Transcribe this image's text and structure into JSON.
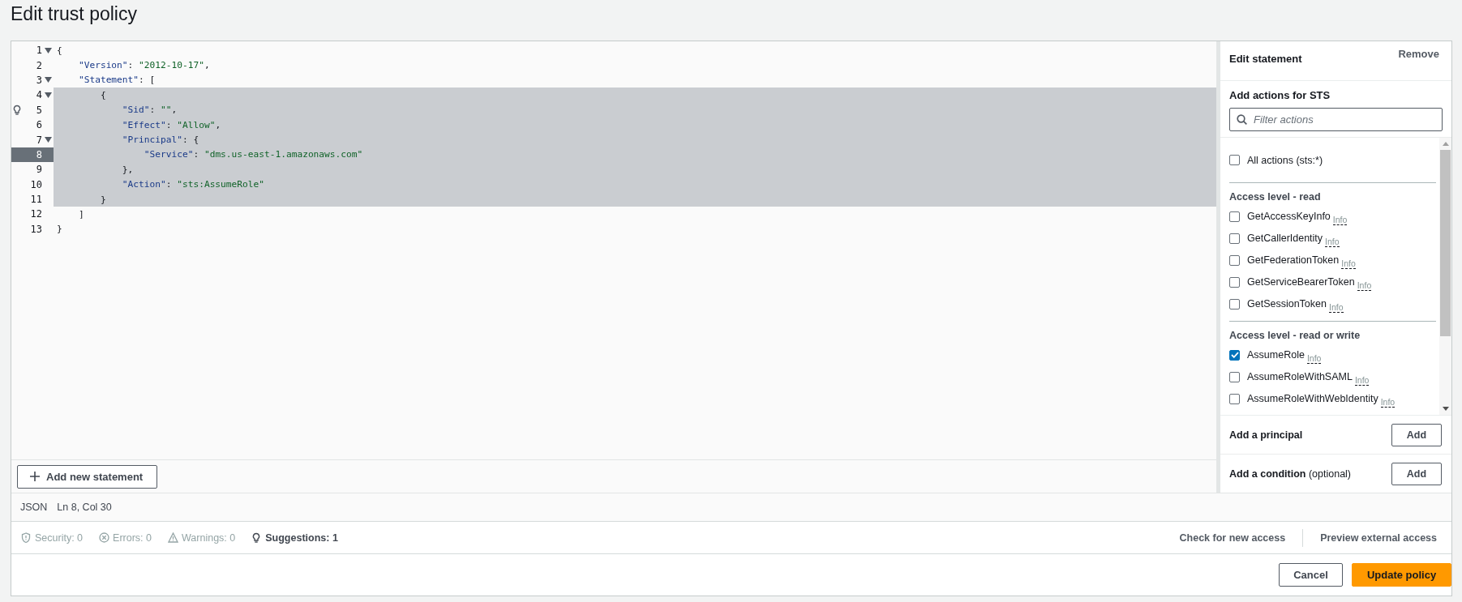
{
  "title": "Edit trust policy",
  "editor": {
    "lines": [
      {
        "number": "1",
        "code": "{",
        "fold": true,
        "selected": false,
        "current": false,
        "suggestion": false
      },
      {
        "number": "2",
        "code": "    \"Version\": \"2012-10-17\",",
        "fold": false,
        "selected": false,
        "current": false,
        "suggestion": false
      },
      {
        "number": "3",
        "code": "    \"Statement\": [",
        "fold": true,
        "selected": false,
        "current": false,
        "suggestion": false
      },
      {
        "number": "4",
        "code": "        {",
        "fold": true,
        "selected": true,
        "current": false,
        "suggestion": false
      },
      {
        "number": "5",
        "code": "            \"Sid\": \"\",",
        "fold": false,
        "selected": true,
        "current": false,
        "suggestion": true
      },
      {
        "number": "6",
        "code": "            \"Effect\": \"Allow\",",
        "fold": false,
        "selected": true,
        "current": false,
        "suggestion": false
      },
      {
        "number": "7",
        "code": "            \"Principal\": {",
        "fold": true,
        "selected": true,
        "current": false,
        "suggestion": false
      },
      {
        "number": "8",
        "code": "                \"Service\": \"dms.us-east-1.amazonaws.com\"",
        "fold": false,
        "selected": true,
        "current": true,
        "suggestion": false
      },
      {
        "number": "9",
        "code": "            },",
        "fold": false,
        "selected": true,
        "current": false,
        "suggestion": false
      },
      {
        "number": "10",
        "code": "            \"Action\": \"sts:AssumeRole\"",
        "fold": false,
        "selected": true,
        "current": false,
        "suggestion": false
      },
      {
        "number": "11",
        "code": "        }",
        "fold": false,
        "selected": true,
        "current": false,
        "suggestion": false
      },
      {
        "number": "12",
        "code": "    ]",
        "fold": false,
        "selected": false,
        "current": false,
        "suggestion": false
      },
      {
        "number": "13",
        "code": "}",
        "fold": false,
        "selected": false,
        "current": false,
        "suggestion": false
      }
    ],
    "add_statement": "Add new statement",
    "status": {
      "language": "JSON",
      "position": "Ln 8, Col 30"
    }
  },
  "panel": {
    "heading": "Edit statement",
    "remove": "Remove",
    "actions_title": "Add actions for STS",
    "filter": {
      "placeholder": "Filter actions"
    },
    "all_actions": {
      "label": "All actions (sts:*)",
      "checked": false
    },
    "groups": [
      {
        "title": "Access level - read",
        "actions": [
          {
            "name": "GetAccessKeyInfo",
            "info": "Info",
            "checked": false
          },
          {
            "name": "GetCallerIdentity",
            "info": "Info",
            "checked": false
          },
          {
            "name": "GetFederationToken",
            "info": "Info",
            "checked": false
          },
          {
            "name": "GetServiceBearerToken",
            "info": "Info",
            "checked": false
          },
          {
            "name": "GetSessionToken",
            "info": "Info",
            "checked": false
          }
        ]
      },
      {
        "title": "Access level - read or write",
        "actions": [
          {
            "name": "AssumeRole",
            "info": "Info",
            "checked": true
          },
          {
            "name": "AssumeRoleWithSAML",
            "info": "Info",
            "checked": false
          },
          {
            "name": "AssumeRoleWithWebIdentity",
            "info": "Info",
            "checked": false
          }
        ]
      }
    ],
    "sections": [
      {
        "label": "Add a principal",
        "button": "Add"
      },
      {
        "label": "Add a condition",
        "note": "(optional)",
        "button": "Add"
      }
    ]
  },
  "findings": [
    {
      "kind": "security",
      "label": "Security: 0",
      "active": false
    },
    {
      "kind": "errors",
      "label": "Errors: 0",
      "active": false
    },
    {
      "kind": "warnings",
      "label": "Warnings: 0",
      "active": false
    },
    {
      "kind": "suggestions",
      "label": "Suggestions: 1",
      "active": true
    }
  ],
  "links": [
    "Check for new access",
    "Preview external access"
  ],
  "buttons": [
    {
      "kind": "secondary",
      "label": "Cancel"
    },
    {
      "kind": "primary",
      "label": "Update policy"
    }
  ]
}
